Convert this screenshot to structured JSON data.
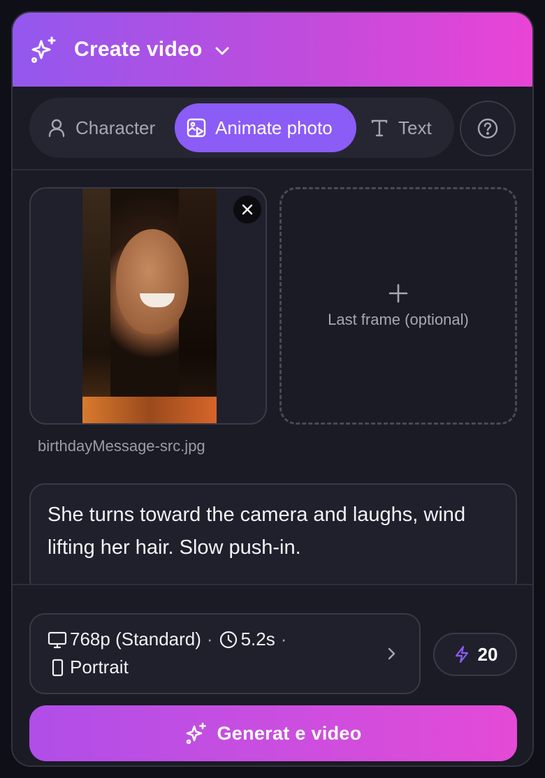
{
  "header": {
    "title": "Create video",
    "icon": "sparkles-icon"
  },
  "modes": {
    "items": [
      {
        "label": "Character",
        "icon": "user-icon",
        "active": false
      },
      {
        "label": "Animate photo",
        "icon": "image-play-icon",
        "active": true
      },
      {
        "label": "Text",
        "icon": "text-icon",
        "active": false
      }
    ],
    "help_icon": "help-circle-icon"
  },
  "first_frame": {
    "filename": "birthdayMessage-src.jpg"
  },
  "last_frame": {
    "label": "Last frame (optional)"
  },
  "prompt": {
    "text": "She turns toward the camera and laughs, wind lifting her hair. Slow push-in."
  },
  "settings": {
    "resolution": "768p (Standard)",
    "duration": "5.2s",
    "separator": "·",
    "orientation": "Portrait"
  },
  "credits": {
    "value": "20"
  },
  "generate": {
    "label": "Generat e video"
  },
  "colors": {
    "accent": "#8b5cf6",
    "header_start": "#9358ee",
    "header_end": "#e944d6",
    "panel_bg": "#1b1b26",
    "credits_icon": "#8b5cf6"
  }
}
